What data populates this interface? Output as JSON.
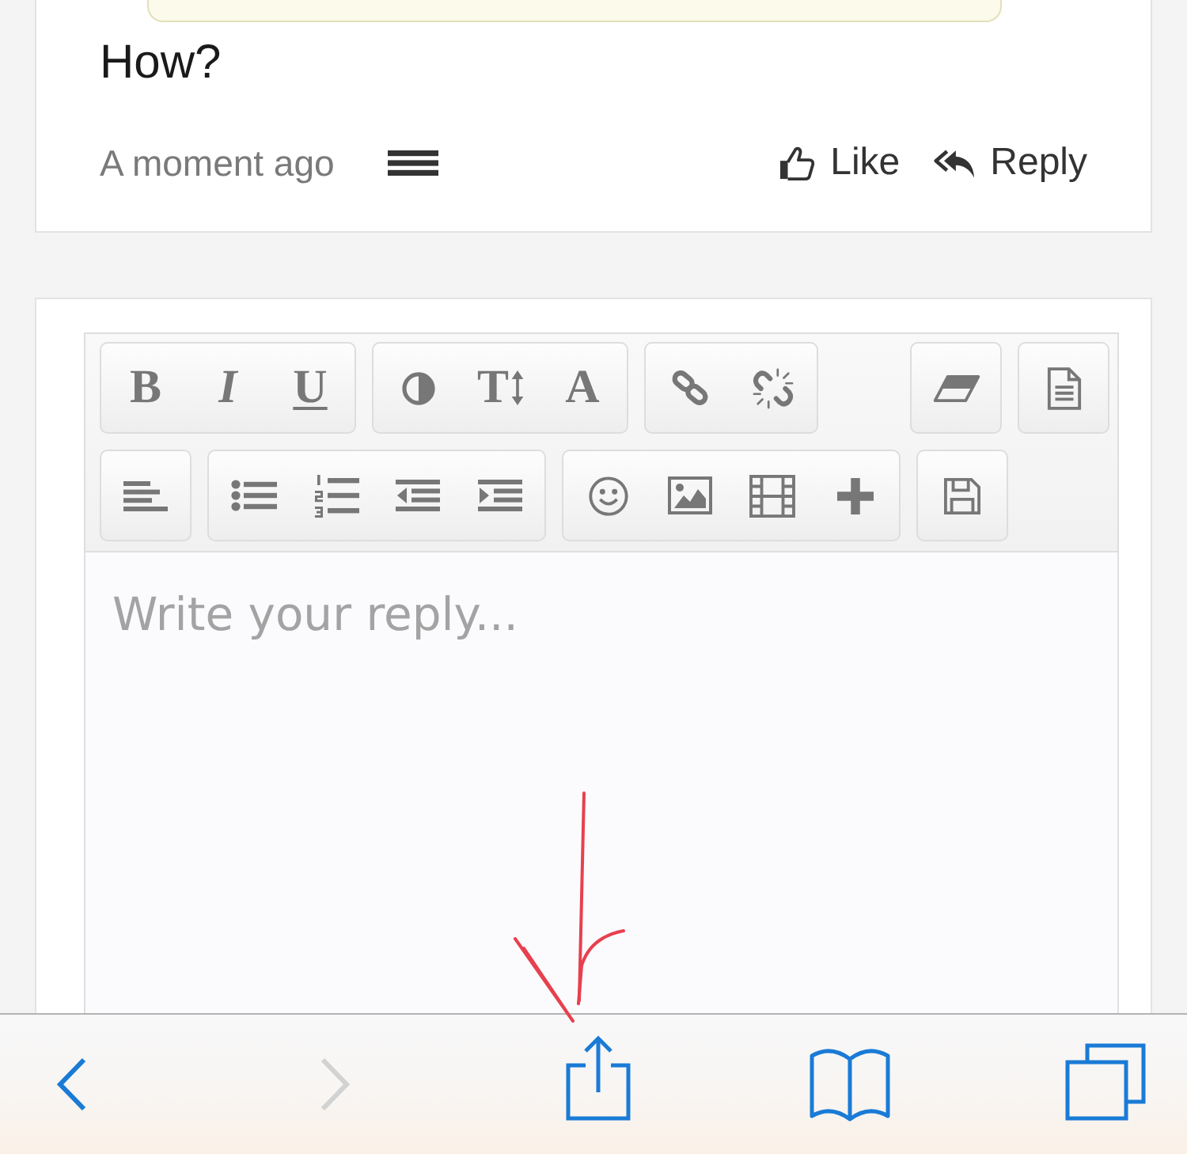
{
  "comment": {
    "text": "How?",
    "time": "A moment ago",
    "actions": [
      {
        "kind": "like",
        "label": "Like"
      },
      {
        "kind": "reply",
        "label": "Reply"
      }
    ]
  },
  "editor": {
    "toolbar": {
      "rows": [
        {
          "start": [
            {
              "buttons": [
                {
                  "kind": "bold",
                  "label": "B"
                },
                {
                  "kind": "italic",
                  "label": "I"
                },
                {
                  "kind": "underline",
                  "label": "U"
                }
              ]
            },
            {
              "buttons": [
                {
                  "kind": "contrast"
                },
                {
                  "kind": "size",
                  "label": "T"
                },
                {
                  "kind": "font",
                  "label": "A"
                }
              ]
            },
            {
              "buttons": [
                {
                  "kind": "link"
                },
                {
                  "kind": "unlink"
                }
              ]
            }
          ],
          "end": [
            {
              "buttons": [
                {
                  "kind": "eraser"
                }
              ]
            },
            {
              "buttons": [
                {
                  "kind": "source"
                }
              ]
            }
          ]
        },
        {
          "start": [
            {
              "buttons": [
                {
                  "kind": "align"
                }
              ]
            },
            {
              "buttons": [
                {
                  "kind": "bullets"
                },
                {
                  "kind": "numbers"
                },
                {
                  "kind": "outdent"
                },
                {
                  "kind": "indent"
                }
              ]
            },
            {
              "buttons": [
                {
                  "kind": "emoji"
                },
                {
                  "kind": "image"
                },
                {
                  "kind": "video"
                },
                {
                  "kind": "insert"
                }
              ]
            },
            {
              "buttons": [
                {
                  "kind": "save"
                }
              ]
            }
          ]
        }
      ]
    },
    "placeholder": "Write your reply..."
  },
  "browser_toolbar": {
    "buttons": [
      {
        "kind": "back",
        "disabled": false
      },
      {
        "kind": "forward",
        "disabled": true
      },
      {
        "kind": "share",
        "disabled": false
      },
      {
        "kind": "bookmarks",
        "disabled": false
      },
      {
        "kind": "tabs",
        "disabled": false
      }
    ]
  }
}
